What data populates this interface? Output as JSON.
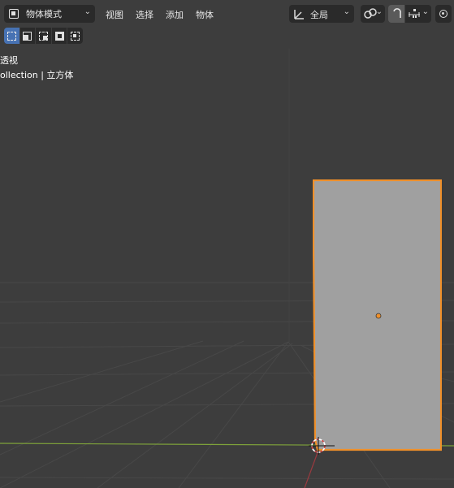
{
  "header": {
    "mode_select": {
      "label": "物体模式",
      "icon": "object-mode-icon"
    },
    "menus": [
      {
        "label": "视图"
      },
      {
        "label": "选择"
      },
      {
        "label": "添加"
      },
      {
        "label": "物体"
      }
    ],
    "pivot": {
      "label": "全局",
      "icon": "transform-orientation-icon"
    },
    "snap": {
      "icon": "link-icon"
    },
    "magnet": {
      "icon": "magnet-icon",
      "active": true
    },
    "snap_to": {
      "icon": "increment-snap-icon"
    },
    "proportional_edit": {
      "icon": "proportional-edit-icon"
    }
  },
  "select_modes": [
    {
      "name": "set-new",
      "active": true
    },
    {
      "name": "extend"
    },
    {
      "name": "subtract"
    },
    {
      "name": "invert"
    },
    {
      "name": "intersect"
    }
  ],
  "viewport": {
    "view_name": "透视",
    "collection_line": "ollection | 立方体",
    "colors": {
      "background": "#3d3d3d",
      "grid": "#484848",
      "x_axis": "#7ea23a",
      "y_axis": "#9b3a3f",
      "selection_outline": "#f0902a",
      "object_fill": "#9f9f9f",
      "origin_dot": "#f0902a"
    }
  }
}
